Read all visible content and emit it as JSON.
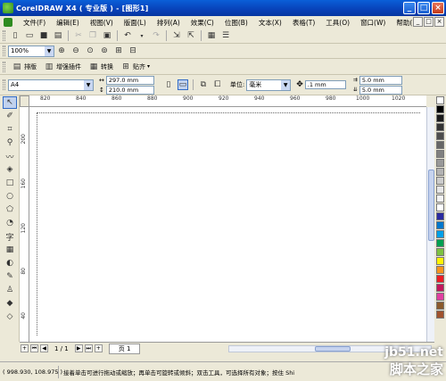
{
  "window": {
    "title": "CorelDRAW X4 ( 专业版 ) - [图形1]",
    "minimize": "_",
    "maximize": "□",
    "close": "×"
  },
  "menu": [
    "文件(F)",
    "编辑(E)",
    "视图(V)",
    "版面(L)",
    "排列(A)",
    "效果(C)",
    "位图(B)",
    "文本(X)",
    "表格(T)",
    "工具(O)",
    "窗口(W)",
    "帮助(H)"
  ],
  "zoom": {
    "value": "100%"
  },
  "plugin_bar": {
    "items": [
      "排版",
      "增强插件",
      "转换",
      "贴齐"
    ]
  },
  "property_bar": {
    "paper": "A4",
    "width": "297.0 mm",
    "height": "210.0 mm",
    "unit_label": "单位:",
    "unit": "毫米",
    "nudge": ".1 mm",
    "dup_x": "5.0 mm",
    "dup_y": "5.0 mm"
  },
  "ruler": {
    "top_ticks": [
      "820",
      "840",
      "860",
      "880",
      "900",
      "920",
      "940",
      "960",
      "980",
      "1000",
      "1020"
    ],
    "left_ticks": [
      "200",
      "160",
      "120",
      "80",
      "40"
    ]
  },
  "palette": {
    "colors": [
      "#ffffff",
      "#000000",
      "#1a1a1a",
      "#333333",
      "#4d4d4d",
      "#666666",
      "#808080",
      "#999999",
      "#b3b3b3",
      "#cccccc",
      "#e6e6e6",
      "#f2f2f2",
      "#ffffff",
      "#2a2aa0",
      "#0077cc",
      "#00a0e8",
      "#00a050",
      "#7dc242",
      "#fff200",
      "#f7941d",
      "#ed1c24",
      "#c2185b",
      "#e040a0",
      "#8b5a2b",
      "#a0522d"
    ]
  },
  "pagebar": {
    "count": "1 / 1",
    "tab": "页 1"
  },
  "status": {
    "coords": "( 998.930, 108.975 )",
    "hint": "接着单击可进行拖动或缩放；再单击可旋转或倾斜；双击工具，可选择所有对象；按住 Shi"
  },
  "watermark": {
    "site": "jb51.net",
    "cn": "脚本之家"
  }
}
